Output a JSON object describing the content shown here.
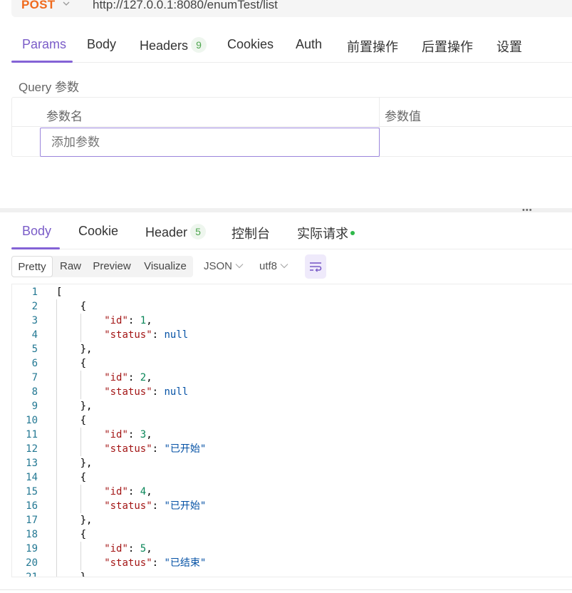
{
  "request": {
    "method": "POST",
    "url": "http://127.0.0.1:8080/enumTest/list"
  },
  "request_tabs": [
    {
      "label": "Params",
      "active": true
    },
    {
      "label": "Body"
    },
    {
      "label": "Headers",
      "badge": "9"
    },
    {
      "label": "Cookies"
    },
    {
      "label": "Auth"
    },
    {
      "label": "前置操作"
    },
    {
      "label": "后置操作"
    },
    {
      "label": "设置"
    }
  ],
  "query": {
    "label": "Query 参数",
    "col_name": "参数名",
    "col_value": "参数值",
    "add_placeholder": "添加参数"
  },
  "response_tabs": [
    {
      "label": "Body",
      "active": true
    },
    {
      "label": "Cookie"
    },
    {
      "label": "Header",
      "badge": "5"
    },
    {
      "label": "控制台"
    },
    {
      "label": "实际请求"
    }
  ],
  "view_modes": [
    "Pretty",
    "Raw",
    "Preview",
    "Visualize"
  ],
  "active_view_mode": "Pretty",
  "format": "JSON",
  "encoding": "utf8",
  "accent_color": "#8463d6",
  "method_color": "#f06a1d",
  "icons": [
    "chevron-down-icon",
    "more-dots-icon",
    "word-wrap-icon",
    "status-dot-icon"
  ],
  "code_lines": [
    {
      "n": "1",
      "indent": 0,
      "tokens": [
        {
          "t": "["
        }
      ]
    },
    {
      "n": "2",
      "indent": 1,
      "tokens": [
        {
          "t": "{"
        }
      ]
    },
    {
      "n": "3",
      "indent": 2,
      "tokens": [
        {
          "t": "\"id\"",
          "c": "k"
        },
        {
          "t": ": "
        },
        {
          "t": "1",
          "c": "n"
        },
        {
          "t": ","
        }
      ]
    },
    {
      "n": "4",
      "indent": 2,
      "tokens": [
        {
          "t": "\"status\"",
          "c": "k"
        },
        {
          "t": ": "
        },
        {
          "t": "null",
          "c": "nl"
        }
      ]
    },
    {
      "n": "5",
      "indent": 1,
      "tokens": [
        {
          "t": "},"
        }
      ]
    },
    {
      "n": "6",
      "indent": 1,
      "tokens": [
        {
          "t": "{"
        }
      ]
    },
    {
      "n": "7",
      "indent": 2,
      "tokens": [
        {
          "t": "\"id\"",
          "c": "k"
        },
        {
          "t": ": "
        },
        {
          "t": "2",
          "c": "n"
        },
        {
          "t": ","
        }
      ]
    },
    {
      "n": "8",
      "indent": 2,
      "tokens": [
        {
          "t": "\"status\"",
          "c": "k"
        },
        {
          "t": ": "
        },
        {
          "t": "null",
          "c": "nl"
        }
      ]
    },
    {
      "n": "9",
      "indent": 1,
      "tokens": [
        {
          "t": "},"
        }
      ]
    },
    {
      "n": "10",
      "indent": 1,
      "tokens": [
        {
          "t": "{"
        }
      ]
    },
    {
      "n": "11",
      "indent": 2,
      "tokens": [
        {
          "t": "\"id\"",
          "c": "k"
        },
        {
          "t": ": "
        },
        {
          "t": "3",
          "c": "n"
        },
        {
          "t": ","
        }
      ]
    },
    {
      "n": "12",
      "indent": 2,
      "tokens": [
        {
          "t": "\"status\"",
          "c": "k"
        },
        {
          "t": ": "
        },
        {
          "t": "\"已开始\"",
          "c": "s"
        }
      ]
    },
    {
      "n": "13",
      "indent": 1,
      "tokens": [
        {
          "t": "},"
        }
      ]
    },
    {
      "n": "14",
      "indent": 1,
      "tokens": [
        {
          "t": "{"
        }
      ]
    },
    {
      "n": "15",
      "indent": 2,
      "tokens": [
        {
          "t": "\"id\"",
          "c": "k"
        },
        {
          "t": ": "
        },
        {
          "t": "4",
          "c": "n"
        },
        {
          "t": ","
        }
      ]
    },
    {
      "n": "16",
      "indent": 2,
      "tokens": [
        {
          "t": "\"status\"",
          "c": "k"
        },
        {
          "t": ": "
        },
        {
          "t": "\"已开始\"",
          "c": "s"
        }
      ]
    },
    {
      "n": "17",
      "indent": 1,
      "tokens": [
        {
          "t": "},"
        }
      ]
    },
    {
      "n": "18",
      "indent": 1,
      "tokens": [
        {
          "t": "{"
        }
      ]
    },
    {
      "n": "19",
      "indent": 2,
      "tokens": [
        {
          "t": "\"id\"",
          "c": "k"
        },
        {
          "t": ": "
        },
        {
          "t": "5",
          "c": "n"
        },
        {
          "t": ","
        }
      ]
    },
    {
      "n": "20",
      "indent": 2,
      "tokens": [
        {
          "t": "\"status\"",
          "c": "k"
        },
        {
          "t": ": "
        },
        {
          "t": "\"已结束\"",
          "c": "s"
        }
      ]
    },
    {
      "n": "21",
      "indent": 1,
      "tokens": [
        {
          "t": "}"
        }
      ]
    }
  ]
}
